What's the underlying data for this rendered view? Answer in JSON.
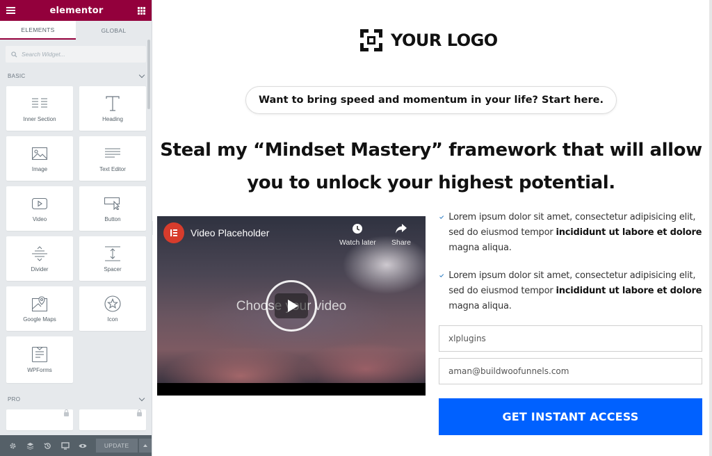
{
  "editor": {
    "brand": "elementor",
    "tabs": [
      {
        "label": "ELEMENTS",
        "active": true
      },
      {
        "label": "GLOBAL",
        "active": false
      }
    ],
    "search_placeholder": "Search Widget...",
    "categories": {
      "basic": "BASIC",
      "pro": "PRO"
    },
    "widgets": [
      {
        "label": "Inner Section",
        "icon": "inner-section-icon"
      },
      {
        "label": "Heading",
        "icon": "heading-icon"
      },
      {
        "label": "Image",
        "icon": "image-icon"
      },
      {
        "label": "Text Editor",
        "icon": "text-editor-icon"
      },
      {
        "label": "Video",
        "icon": "video-icon"
      },
      {
        "label": "Button",
        "icon": "button-icon"
      },
      {
        "label": "Divider",
        "icon": "divider-icon"
      },
      {
        "label": "Spacer",
        "icon": "spacer-icon"
      },
      {
        "label": "Google Maps",
        "icon": "google-maps-icon"
      },
      {
        "label": "Icon",
        "icon": "star-icon"
      },
      {
        "label": "WPForms",
        "icon": "wpforms-icon"
      }
    ],
    "bottombar": {
      "update_label": "UPDATE",
      "icons": [
        "settings-icon",
        "layers-icon",
        "history-icon",
        "responsive-icon",
        "preview-icon"
      ]
    }
  },
  "page": {
    "logo_text": "YOUR LOGO",
    "pill_text": "Want to bring speed and momentum in your life? Start here.",
    "headline_line1": "Steal my “Mindset Mastery” framework that will allow",
    "headline_line2": "you to unlock your highest potential.",
    "video": {
      "title": "Video Placeholder",
      "watch_later": "Watch later",
      "share": "Share",
      "center_text": "Choose your video"
    },
    "bullets": [
      {
        "text": "Lorem ipsum dolor sit amet, consectetur adipisicing elit, sed do eiusmod tempor ",
        "bold": "incididunt ut labore et dolore",
        "tail": " magna aliqua."
      },
      {
        "text": "Lorem ipsum dolor sit amet, consectetur adipisicing elit, sed do eiusmod tempor ",
        "bold": "incididunt ut labore et dolore",
        "tail": " magna aliqua."
      }
    ],
    "form": {
      "name_value": "xlplugins",
      "email_value": "aman@buildwoofunnels.com",
      "button_label": "GET INSTANT ACCESS"
    }
  },
  "colors": {
    "elementor_brand": "#93003c",
    "cta_blue": "#0061ff",
    "check_blue": "#1e73be",
    "video_badge": "#d73c2c"
  }
}
